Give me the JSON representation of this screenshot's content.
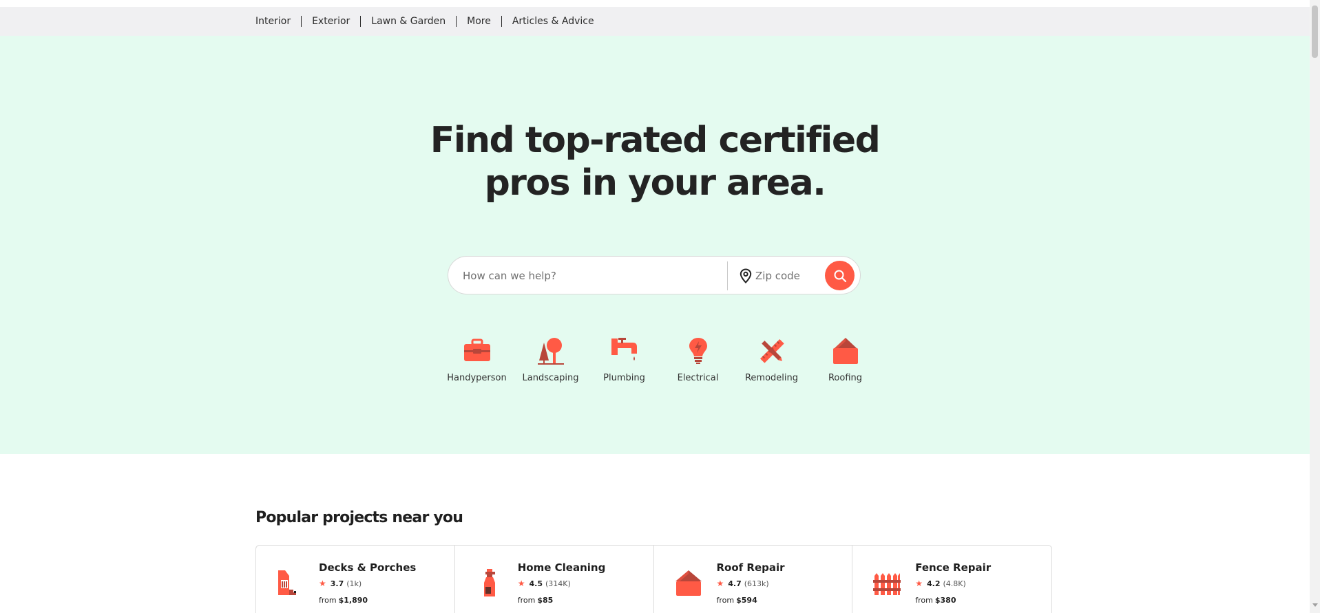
{
  "nav": {
    "items": [
      {
        "label": "Interior"
      },
      {
        "label": "Exterior"
      },
      {
        "label": "Lawn & Garden"
      },
      {
        "label": "More"
      },
      {
        "label": "Articles & Advice"
      }
    ]
  },
  "hero": {
    "headline_line1": "Find top-rated certified",
    "headline_line2": "pros in your area.",
    "search_placeholder": "How can we help?",
    "zip_placeholder": "Zip code"
  },
  "categories": [
    {
      "label": "Handyperson",
      "icon": "toolbox-icon"
    },
    {
      "label": "Landscaping",
      "icon": "tree-icon"
    },
    {
      "label": "Plumbing",
      "icon": "faucet-icon"
    },
    {
      "label": "Electrical",
      "icon": "lightbulb-icon"
    },
    {
      "label": "Remodeling",
      "icon": "ruler-pencil-icon"
    },
    {
      "label": "Roofing",
      "icon": "house-roof-icon"
    }
  ],
  "popular": {
    "title": "Popular projects near you",
    "projects": [
      {
        "title": "Decks & Porches",
        "rating": "3.7",
        "count": "(1k)",
        "price_prefix": "from",
        "price": "$1,890",
        "icon": "deck-paint-icon"
      },
      {
        "title": "Home Cleaning",
        "rating": "4.5",
        "count": "(314K)",
        "price_prefix": "from",
        "price": "$85",
        "icon": "spray-bottle-icon"
      },
      {
        "title": "Roof Repair",
        "rating": "4.7",
        "count": "(613k)",
        "price_prefix": "from",
        "price": "$594",
        "icon": "house-roof-icon"
      },
      {
        "title": "Fence Repair",
        "rating": "4.2",
        "count": "(4.8K)",
        "price_prefix": "from",
        "price": "$380",
        "icon": "fence-icon"
      }
    ]
  },
  "colors": {
    "accent": "#ff5a45",
    "accent_dark": "#b8463a",
    "hero_bg": "#e4fbf0",
    "nav_bg": "#f0f0f2",
    "text": "#1f1f1f"
  }
}
